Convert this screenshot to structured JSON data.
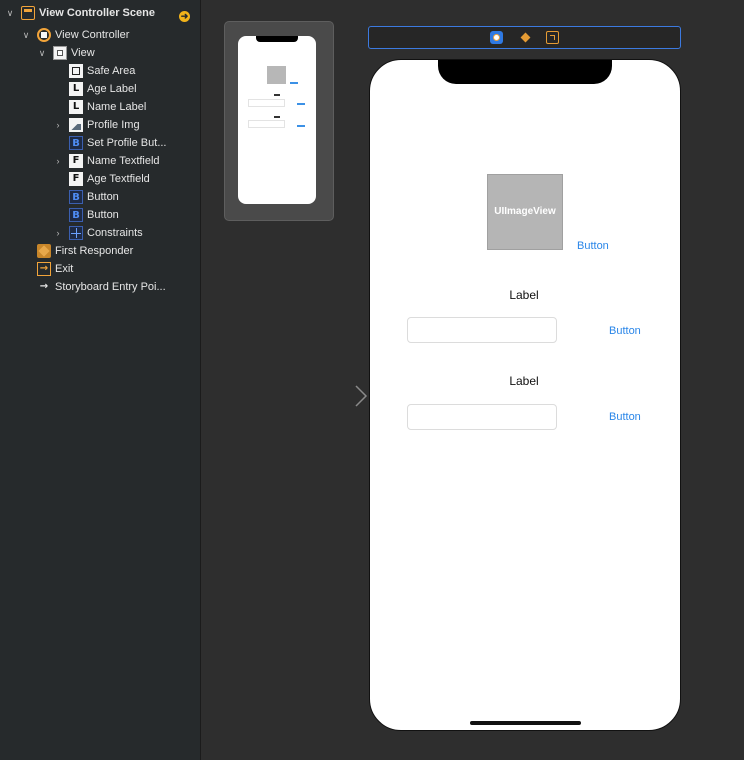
{
  "navigator": {
    "scene_title": "View Controller Scene",
    "items": [
      {
        "label": "View Controller"
      },
      {
        "label": "View"
      },
      {
        "label": "Safe Area"
      },
      {
        "label": "Age Label",
        "glyph": "L"
      },
      {
        "label": "Name Label",
        "glyph": "L"
      },
      {
        "label": "Profile Img"
      },
      {
        "label": "Set Profile But...",
        "glyph": "B"
      },
      {
        "label": "Name Textfield",
        "glyph": "F"
      },
      {
        "label": "Age Textfield",
        "glyph": "F"
      },
      {
        "label": "Button",
        "glyph": "B"
      },
      {
        "label": "Button",
        "glyph": "B"
      },
      {
        "label": "Constraints"
      },
      {
        "label": "First Responder"
      },
      {
        "label": "Exit"
      },
      {
        "label": "Storyboard Entry Poi..."
      }
    ]
  },
  "canvas": {
    "image_view_text": "UIImageView",
    "profile_button_label": "Button",
    "name_label": "Label",
    "name_button_label": "Button",
    "age_label": "Label",
    "age_button_label": "Button"
  },
  "colors": {
    "accent_orange": "#f2a43a",
    "ios_blue": "#2a86e8",
    "selection_blue": "#3c7ae0"
  },
  "icons": {
    "scene": "scene-icon",
    "view_controller": "view-controller-icon",
    "first_responder": "cube-icon",
    "exit": "exit-icon",
    "entry": "arrow-right-icon"
  }
}
